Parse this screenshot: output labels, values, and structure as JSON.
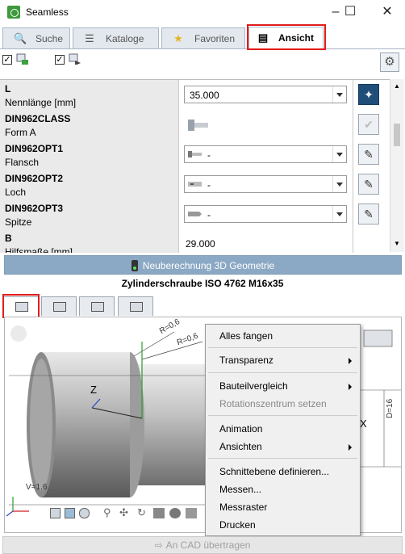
{
  "window": {
    "title": "Seamless"
  },
  "tabs": [
    {
      "label": "Suche",
      "icon": "search-icon"
    },
    {
      "label": "Kataloge",
      "icon": "books-icon"
    },
    {
      "label": "Favoriten",
      "icon": "star-icon"
    },
    {
      "label": "Ansicht",
      "icon": "screw-view-icon",
      "active": true
    }
  ],
  "params": [
    {
      "key": "L",
      "desc": "Nennlänge [mm]",
      "value": "35.000",
      "kind": "combo",
      "action": "pin-icon"
    },
    {
      "key": "DIN962CLASS",
      "desc": "Form A",
      "value": "",
      "kind": "image",
      "action": "check-icon"
    },
    {
      "key": "DIN962OPT1",
      "desc": "Flansch",
      "value": "-",
      "kind": "combo",
      "action": "edit-icon"
    },
    {
      "key": "DIN962OPT2",
      "desc": "Loch",
      "value": "-",
      "kind": "combo",
      "action": "edit-icon"
    },
    {
      "key": "DIN962OPT3",
      "desc": "Spitze",
      "value": "-",
      "kind": "combo",
      "action": "edit-icon"
    },
    {
      "key": "B",
      "desc": "Hilfsmaße [mm]",
      "value": "29.000",
      "kind": "text",
      "action": ""
    }
  ],
  "recalc_label": "Neuberechnung 3D Geometrie",
  "part_name": "Zylinderschraube ISO 4762 M16x35",
  "view3d": {
    "dim_labels": {
      "r1": "R=0,6",
      "r2": "R=0,6",
      "v": "V=1,6",
      "d": "D=16",
      "z": "Z",
      "x": "X"
    }
  },
  "context_menu": {
    "items": [
      {
        "label": "Alles fangen",
        "enabled": true,
        "submenu": false
      },
      {
        "label": "Transparenz",
        "enabled": true,
        "submenu": true
      },
      {
        "label": "Bauteilvergleich",
        "enabled": true,
        "submenu": true
      },
      {
        "label": "Rotationszentrum setzen",
        "enabled": false,
        "submenu": false
      },
      {
        "label": "Animation",
        "enabled": true,
        "submenu": false
      },
      {
        "label": "Ansichten",
        "enabled": true,
        "submenu": true
      },
      {
        "label": "Schnittebene definieren...",
        "enabled": true,
        "submenu": false
      },
      {
        "label": "Messen...",
        "enabled": true,
        "submenu": false
      },
      {
        "label": "Messraster",
        "enabled": true,
        "submenu": false
      },
      {
        "label": "Drucken",
        "enabled": true,
        "submenu": false
      }
    ]
  },
  "cad_button_label": "An CAD übertragen",
  "colors": {
    "highlight": "#e21b1b",
    "accent_blue": "#1f4e79",
    "recalc_bg": "#8ba8c4",
    "app_icon": "#3d9a3d"
  }
}
